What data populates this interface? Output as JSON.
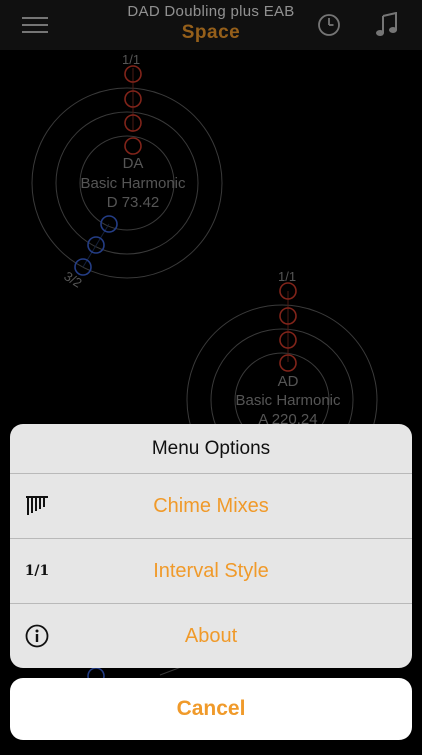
{
  "header": {
    "subtitle": "DAD Doubling plus EAB",
    "title": "Space",
    "menu_icon": "hamburger-menu-icon",
    "history_icon": "clock-icon",
    "music_icon": "music-note-icon"
  },
  "canvas": {
    "nodes": [
      {
        "top_ratio": "1/1",
        "name": "DA",
        "harmonic": "Basic Harmonic",
        "note": "D 73.42",
        "bottom_ratio": "3/2"
      },
      {
        "top_ratio": "1/1",
        "name": "AD",
        "harmonic": "Basic Harmonic",
        "note": "A 220.24"
      }
    ]
  },
  "menu": {
    "title": "Menu Options",
    "items": [
      {
        "label": "Chime Mixes",
        "icon": "chimes-icon"
      },
      {
        "label": "Interval Style",
        "icon": "ratio-icon",
        "icon_text": "1/1"
      },
      {
        "label": "About",
        "icon": "info-icon"
      }
    ],
    "cancel_label": "Cancel"
  },
  "colors": {
    "accent": "#f09a2a",
    "red_node": "#d03a2a",
    "blue_node": "#3a63d8",
    "ring": "#6a6a6a"
  }
}
